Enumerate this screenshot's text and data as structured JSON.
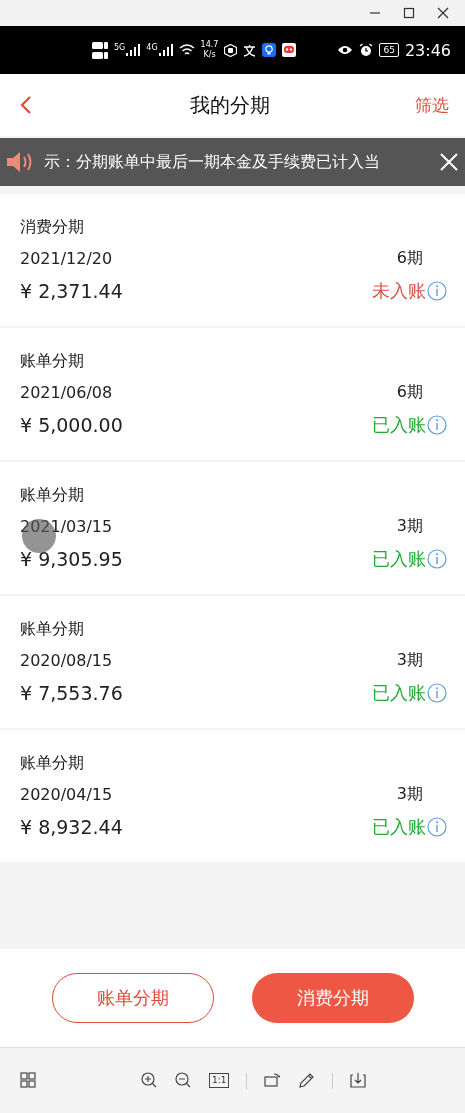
{
  "status_bar": {
    "network_labels": [
      "5G",
      "4G"
    ],
    "speed_value": "14.7",
    "speed_unit": "K/s",
    "battery": "65",
    "time": "23:46"
  },
  "header": {
    "title": "我的分期",
    "action": "筛选"
  },
  "notice": {
    "text": "示：分期账单中最后一期本金及手续费已计入当"
  },
  "installments": [
    {
      "type": "消费分期",
      "date": "2021/12/20",
      "periods": "6期",
      "amount": "¥ 2,371.44",
      "status": "未入账",
      "kind": "pending",
      "touched": false
    },
    {
      "type": "账单分期",
      "date": "2021/06/08",
      "periods": "6期",
      "amount": "¥ 5,000.00",
      "status": "已入账",
      "kind": "posted",
      "touched": false
    },
    {
      "type": "账单分期",
      "date": "2021/03/15",
      "periods": "3期",
      "amount": "¥ 9,305.95",
      "status": "已入账",
      "kind": "posted",
      "touched": true
    },
    {
      "type": "账单分期",
      "date": "2020/08/15",
      "periods": "3期",
      "amount": "¥ 7,553.76",
      "status": "已入账",
      "kind": "posted",
      "touched": false
    },
    {
      "type": "账单分期",
      "date": "2020/04/15",
      "periods": "3期",
      "amount": "¥ 8,932.44",
      "status": "已入账",
      "kind": "posted",
      "touched": false
    }
  ],
  "buttons": [
    {
      "label": "账单分期",
      "kind": "outline"
    },
    {
      "label": "消费分期",
      "kind": "filled"
    }
  ],
  "viewer_toolbar": [
    {
      "kind": "grid"
    },
    {
      "kind": "gap"
    },
    {
      "kind": "zoom-in"
    },
    {
      "kind": "zoom-out"
    },
    {
      "kind": "actual-size",
      "label": "1:1"
    },
    {
      "kind": "divider"
    },
    {
      "kind": "rotate"
    },
    {
      "kind": "pencil"
    },
    {
      "kind": "divider"
    },
    {
      "kind": "download"
    }
  ]
}
